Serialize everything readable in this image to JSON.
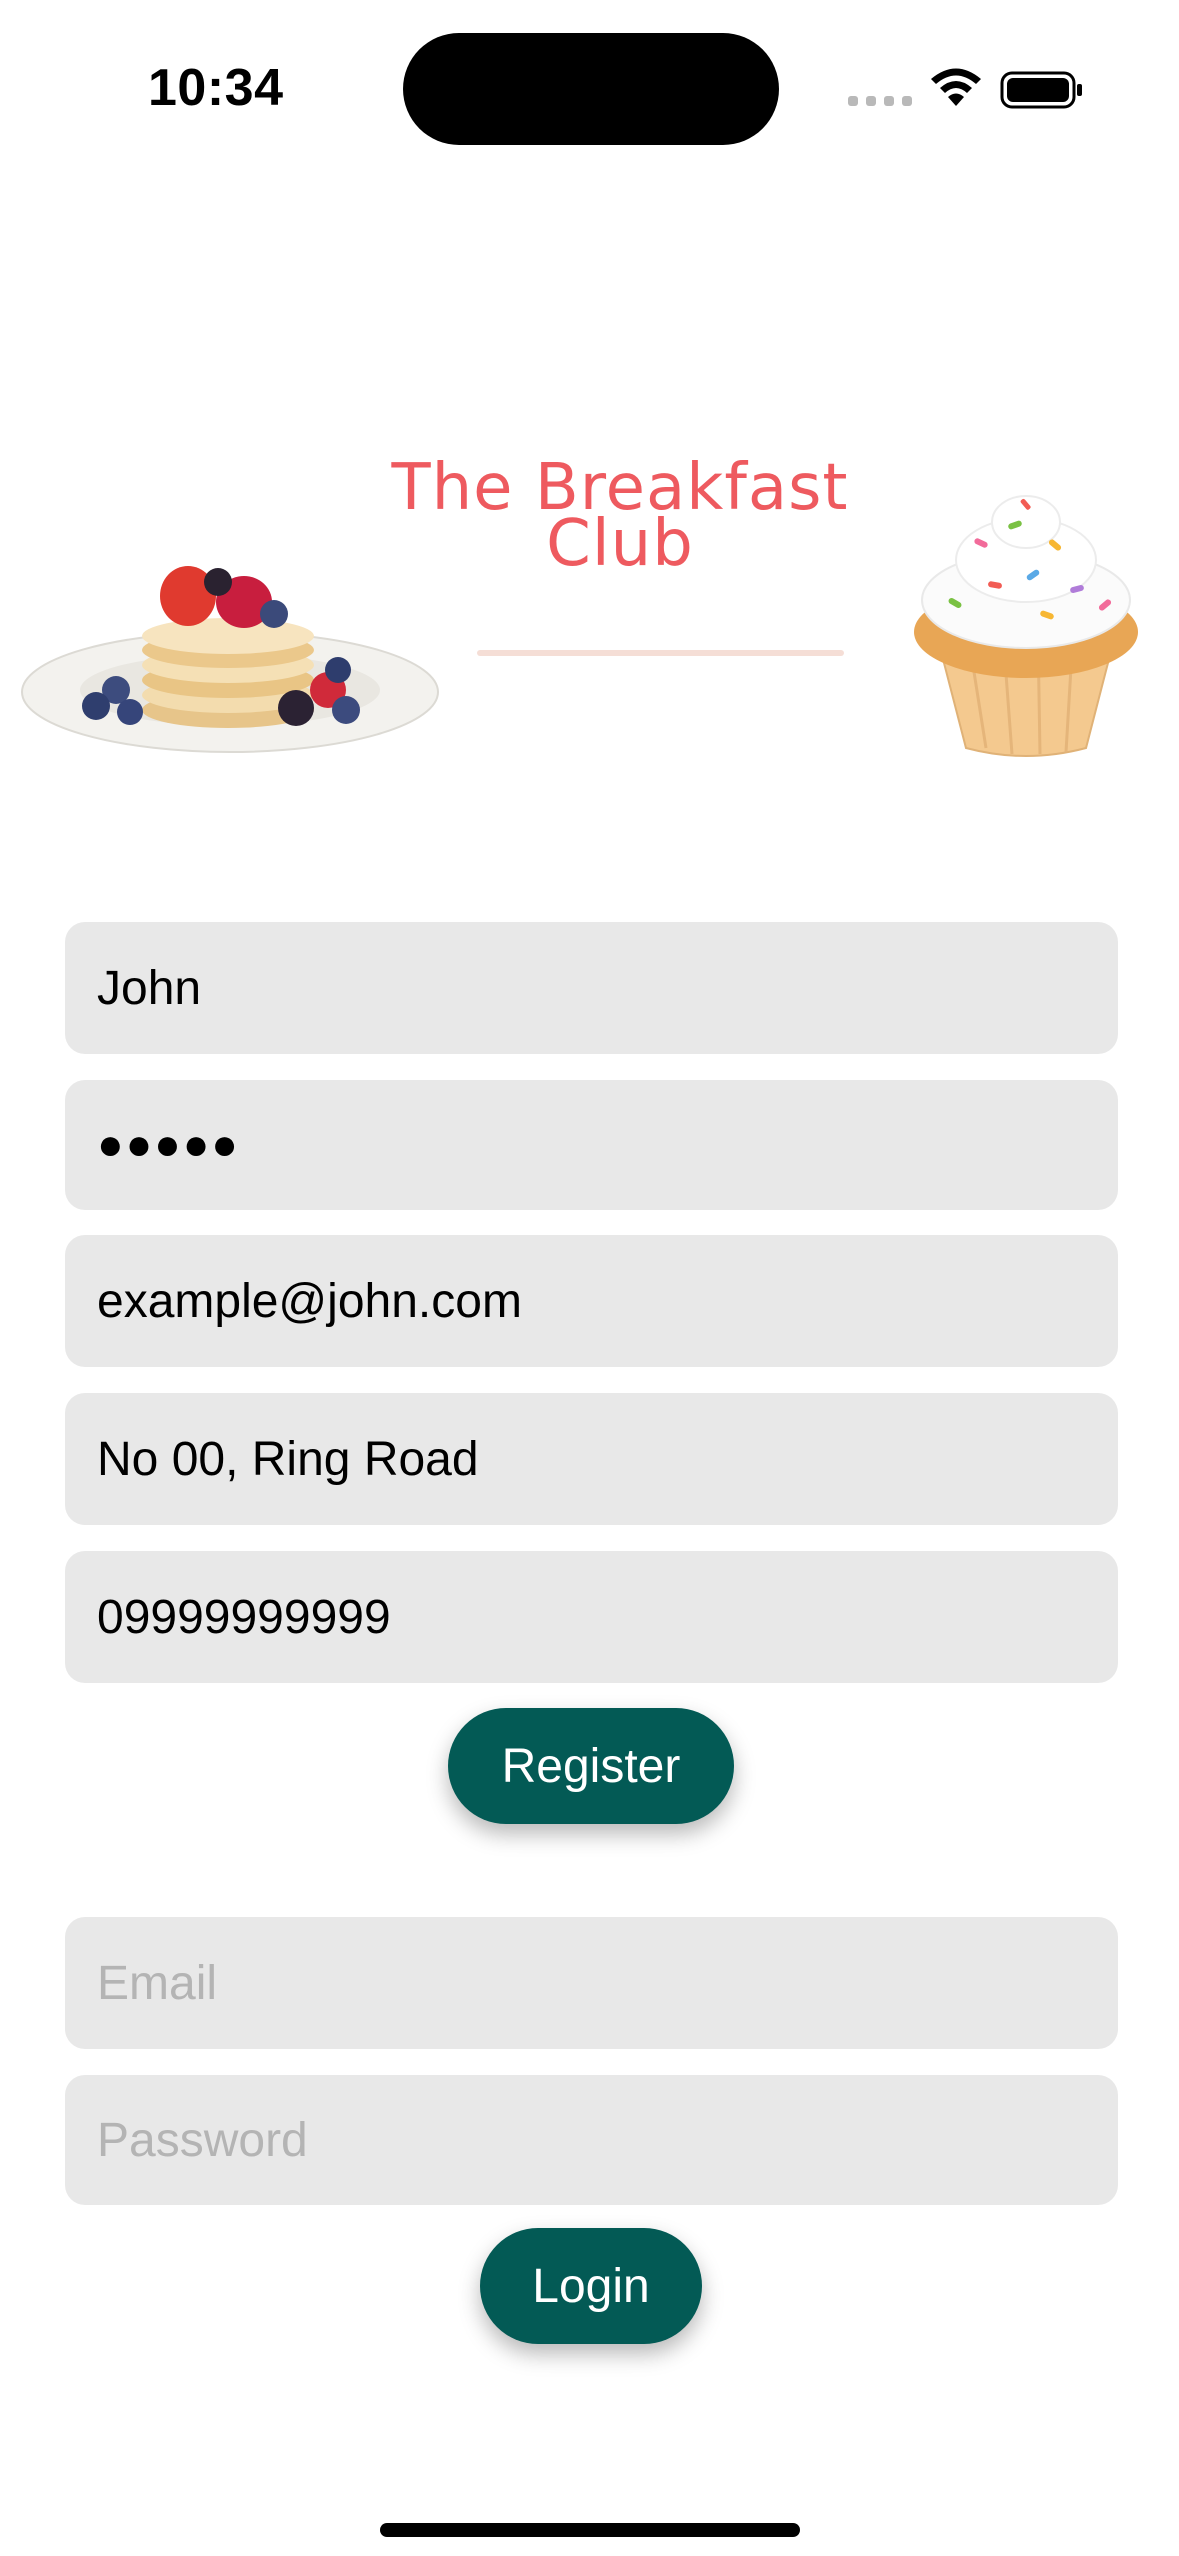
{
  "status_bar": {
    "time": "10:34"
  },
  "hero": {
    "title_line1": "The Breakfast",
    "title_line2": "Club",
    "title_color": "#ee5a5f"
  },
  "register_form": {
    "name_value": "John",
    "password_value": "●●●●●",
    "email_value": "example@john.com",
    "address_value": "No 00, Ring Road",
    "phone_value": "09999999999",
    "register_label": "Register"
  },
  "login_form": {
    "email_placeholder": "Email",
    "password_placeholder": "Password",
    "login_label": "Login"
  },
  "colors": {
    "field_background": "#e8e8e8",
    "button_background": "#035a55",
    "placeholder_text": "#b4b4b4"
  },
  "icons": [
    "wifi-icon",
    "battery-icon",
    "cellular-signal-icon"
  ],
  "images": [
    "pancake-plate-image",
    "cupcake-image"
  ]
}
